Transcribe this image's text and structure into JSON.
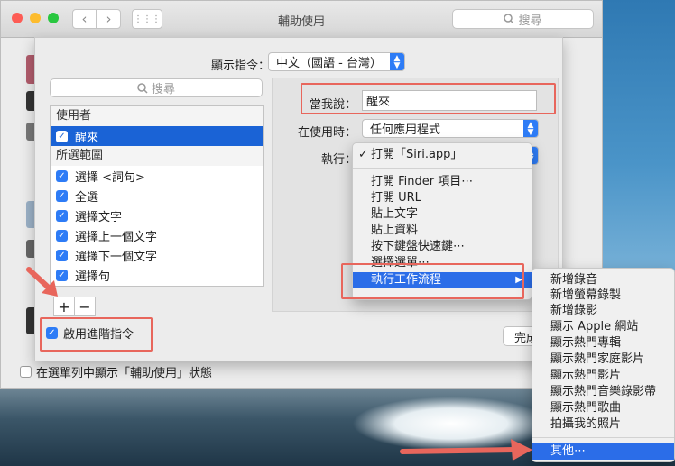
{
  "window": {
    "title": "輔助使用",
    "search_placeholder": "搜尋",
    "back": "‹",
    "forward": "›",
    "grid": "⋮⋮⋮"
  },
  "settings": {
    "show_in_menubar": "在選單列中顯示「輔助使用」狀態"
  },
  "sheet": {
    "dictation_label": "顯示指令：",
    "dictation_value": "中文（國語 - 台灣）",
    "search_placeholder": "搜尋",
    "list": {
      "user_header": "使用者",
      "user_items": [
        "醒來"
      ],
      "selection_header": "所選範圍",
      "selection_items": [
        "選擇 <詞句>",
        "全選",
        "選擇文字",
        "選擇上一個文字",
        "選擇下一個文字",
        "選擇句"
      ]
    },
    "plus": "+",
    "minus": "−",
    "advanced_label": "啟用進階指令",
    "when_i_say_label": "當我說：",
    "when_i_say_value": "醒來",
    "while_using_label": "在使用時：",
    "while_using_value": "任何應用程式",
    "perform_label": "執行：",
    "done_label": "完成"
  },
  "perform_menu": {
    "items": [
      "打開「Siri.app」",
      "打開 Finder 項目⋯",
      "打開 URL",
      "貼上文字",
      "貼上資料",
      "按下鍵盤快速鍵⋯",
      "選擇選單⋯",
      "執行工作流程"
    ],
    "checked": "✓",
    "submenu_arrow": "▶"
  },
  "workflow_submenu": {
    "items": [
      "新增錄音",
      "新增螢幕錄製",
      "新增錄影",
      "顯示 Apple 網站",
      "顯示熱門專輯",
      "顯示熱門家庭影片",
      "顯示熱門影片",
      "顯示熱門音樂錄影帶",
      "顯示熱門歌曲",
      "拍攝我的照片"
    ],
    "other": "其他⋯"
  },
  "colors": {
    "accent": "#2e7cf6",
    "highlight": "#2b6de8",
    "annotation": "#e8665c"
  }
}
